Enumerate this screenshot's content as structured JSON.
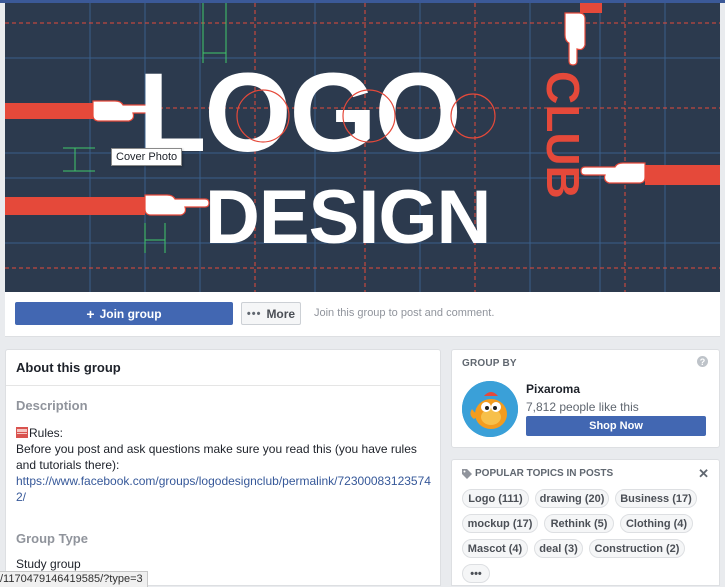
{
  "cover": {
    "tooltip": "Cover Photo",
    "logo_word": "LOGO",
    "design_word": "DESIGN",
    "club_word": "CLUB"
  },
  "actions": {
    "join_label": "Join group",
    "more_label": "More",
    "join_hint": "Join this group to post and comment."
  },
  "about": {
    "title": "About this group",
    "description_label": "Description",
    "rules_label": "Rules:",
    "rules_text": "Before you post and ask questions make sure you read this (you have rules and tutorials there):",
    "rules_link": "https://www.facebook.com/groups/logodesignclub/permalink/723000831235742/",
    "group_type_label": "Group Type",
    "group_type_value": "Study group"
  },
  "group_by": {
    "title": "GROUP BY",
    "page_name": "Pixaroma",
    "likes": "7,812 people like this",
    "shop_label": "Shop Now"
  },
  "topics": {
    "title": "POPULAR TOPICS IN POSTS",
    "chips": [
      {
        "label": "Logo (111)"
      },
      {
        "label": "drawing (20)"
      },
      {
        "label": "Business (17)"
      },
      {
        "label": "mockup (17)"
      },
      {
        "label": "Rethink (5)"
      },
      {
        "label": "Clothing (4)"
      },
      {
        "label": "Mascot (4)"
      },
      {
        "label": "deal (3)"
      },
      {
        "label": "Construction (2)"
      },
      {
        "label": "•••"
      }
    ]
  },
  "status_url": "/1170479146419585/?type=3",
  "colors": {
    "brand_blue": "#4267b2",
    "cover_bg": "#2c3a4e",
    "accent_red": "#e5493a"
  }
}
